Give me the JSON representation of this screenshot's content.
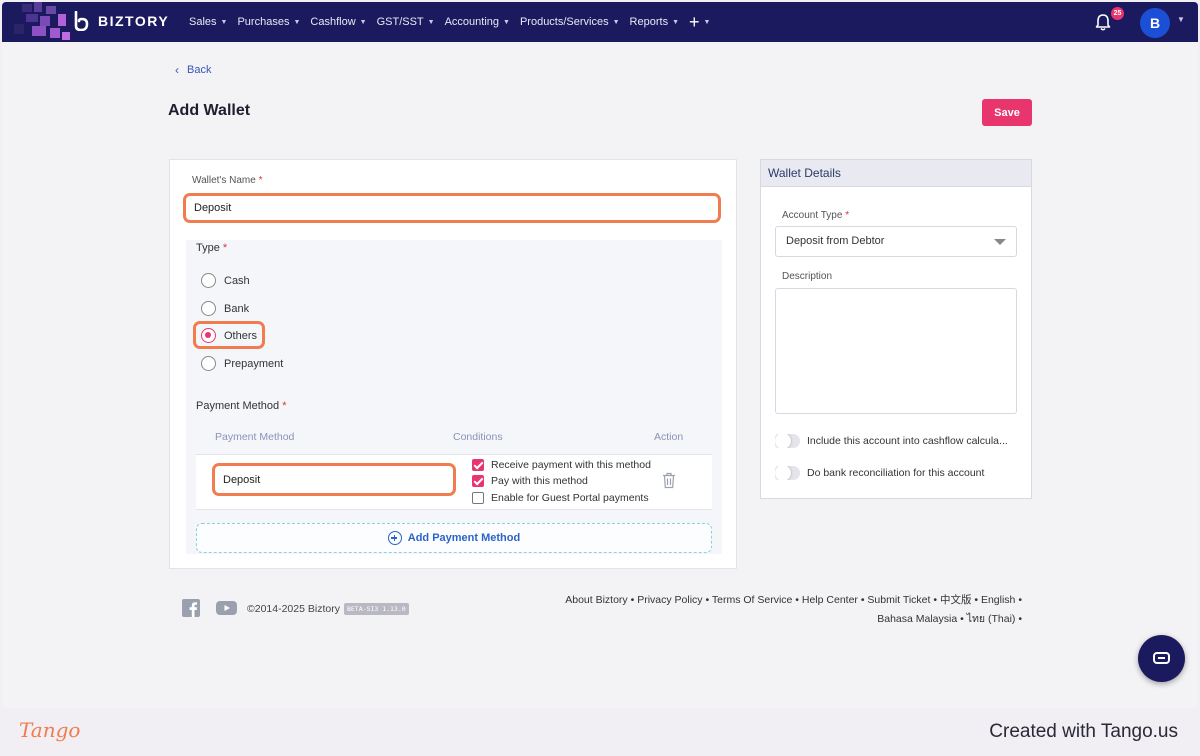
{
  "nav": {
    "brand": "BIZTORY",
    "menu": [
      "Sales",
      "Purchases",
      "Cashflow",
      "GST/SST",
      "Accounting",
      "Products/Services",
      "Reports"
    ],
    "plus": "+",
    "notification_count": "25",
    "avatar_initial": "B"
  },
  "page": {
    "back_label": "Back",
    "title": "Add Wallet",
    "save_label": "Save"
  },
  "form": {
    "wallet_name_label": "Wallet's Name",
    "wallet_name_value": "Deposit",
    "required_mark": "*",
    "type_label": "Type",
    "type_options": [
      "Cash",
      "Bank",
      "Others",
      "Prepayment"
    ],
    "type_selected": "Others",
    "payment_method_label": "Payment Method",
    "columns": [
      "Payment Method",
      "Conditions",
      "Action"
    ],
    "payment_row": {
      "name": "Deposit",
      "conditions": [
        {
          "label": "Receive payment with this method",
          "checked": true
        },
        {
          "label": "Pay with this method",
          "checked": true
        },
        {
          "label": "Enable for Guest Portal payments",
          "checked": false
        }
      ]
    },
    "add_payment_label": "Add Payment Method"
  },
  "details": {
    "title": "Wallet Details",
    "account_type_label": "Account Type",
    "account_type_value": "Deposit from Debtor",
    "description_label": "Description",
    "toggle_cashflow": "Include this account into cashflow calcula...",
    "toggle_reconcile": "Do bank reconciliation for this account"
  },
  "footer": {
    "copyright": "©2014-2025 Biztory",
    "version": "BETA-SI3 1.13.0",
    "links_line1": "About Biztory • Privacy Policy • Terms Of Service • Help Center • Submit Ticket • 中文版 • English •",
    "links_line2": "Bahasa Malaysia • ไทย (Thai) •"
  },
  "tango": {
    "logo": "Tango",
    "created": "Created with Tango.us"
  },
  "colors": {
    "navbar": "#1b1a5e",
    "accent": "#e8356d",
    "highlight": "#f07c4f",
    "link": "#3a56b5"
  }
}
